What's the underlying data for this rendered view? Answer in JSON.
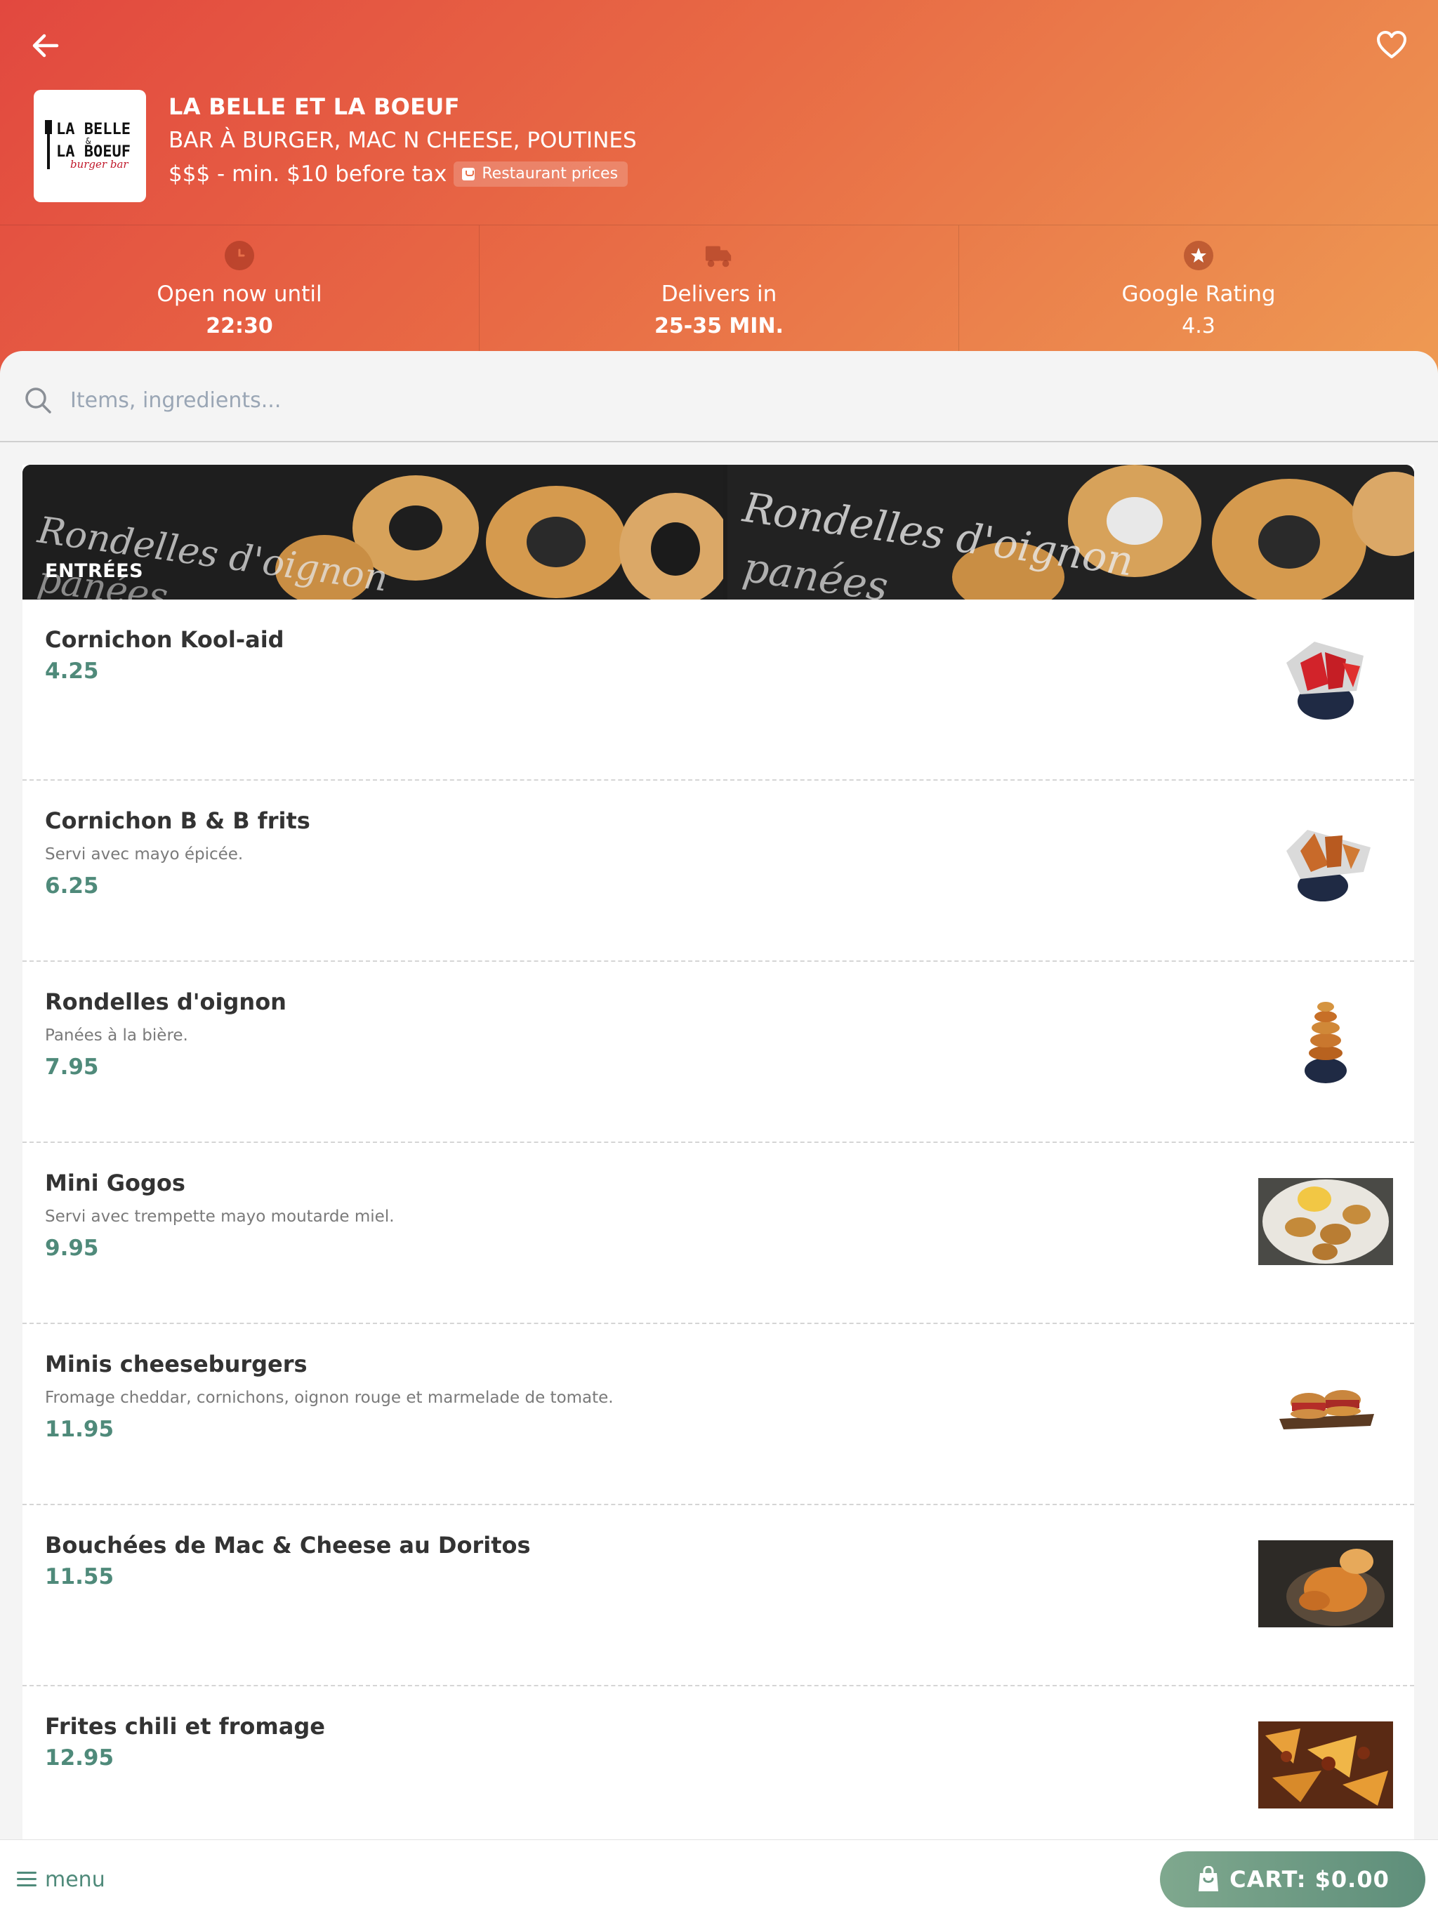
{
  "restaurant": {
    "name": "LA BELLE ET LA BOEUF",
    "categories": "BAR À BURGER, MAC N CHEESE, POUTINES",
    "price_info": "$$$ - min. $10 before tax",
    "price_badge": "Restaurant prices",
    "logo_text": [
      "LA BELLE",
      "&",
      "LA BOEUF",
      "burger bar"
    ]
  },
  "stats": [
    {
      "label": "Open now until",
      "value": "22:30",
      "icon": "clock-icon"
    },
    {
      "label": "Delivers in",
      "value": "25-35 MIN.",
      "icon": "delivery-truck-icon"
    },
    {
      "label": "Google Rating",
      "value": "4.3",
      "icon": "star-icon"
    }
  ],
  "search": {
    "placeholder": "Items, ingredients..."
  },
  "section": {
    "title": "ENTRÉES",
    "banner_text": [
      "Rondelles d'oignon",
      "panées"
    ]
  },
  "items": [
    {
      "name": "Cornichon Kool-aid",
      "description": "",
      "price": "4.25"
    },
    {
      "name": "Cornichon B & B frits",
      "description": "Servi avec mayo épicée.",
      "price": "6.25"
    },
    {
      "name": "Rondelles d'oignon",
      "description": "Panées à la bière.",
      "price": "7.95"
    },
    {
      "name": "Mini Gogos",
      "description": "Servi avec trempette mayo moutarde miel.",
      "price": "9.95"
    },
    {
      "name": "Minis cheeseburgers",
      "description": "Fromage cheddar, cornichons, oignon rouge et marmelade de tomate.",
      "price": "11.95"
    },
    {
      "name": "Bouchées de Mac & Cheese au Doritos",
      "description": "",
      "price": "11.55"
    },
    {
      "name": "Frites chili et fromage",
      "description": "",
      "price": "12.95"
    }
  ],
  "bottom_bar": {
    "menu_label": "menu",
    "cart_label": "CART: $0.00"
  },
  "colors": {
    "accent": "#4f8a7a",
    "header_start": "#e2483f",
    "header_end": "#ee9a53"
  }
}
